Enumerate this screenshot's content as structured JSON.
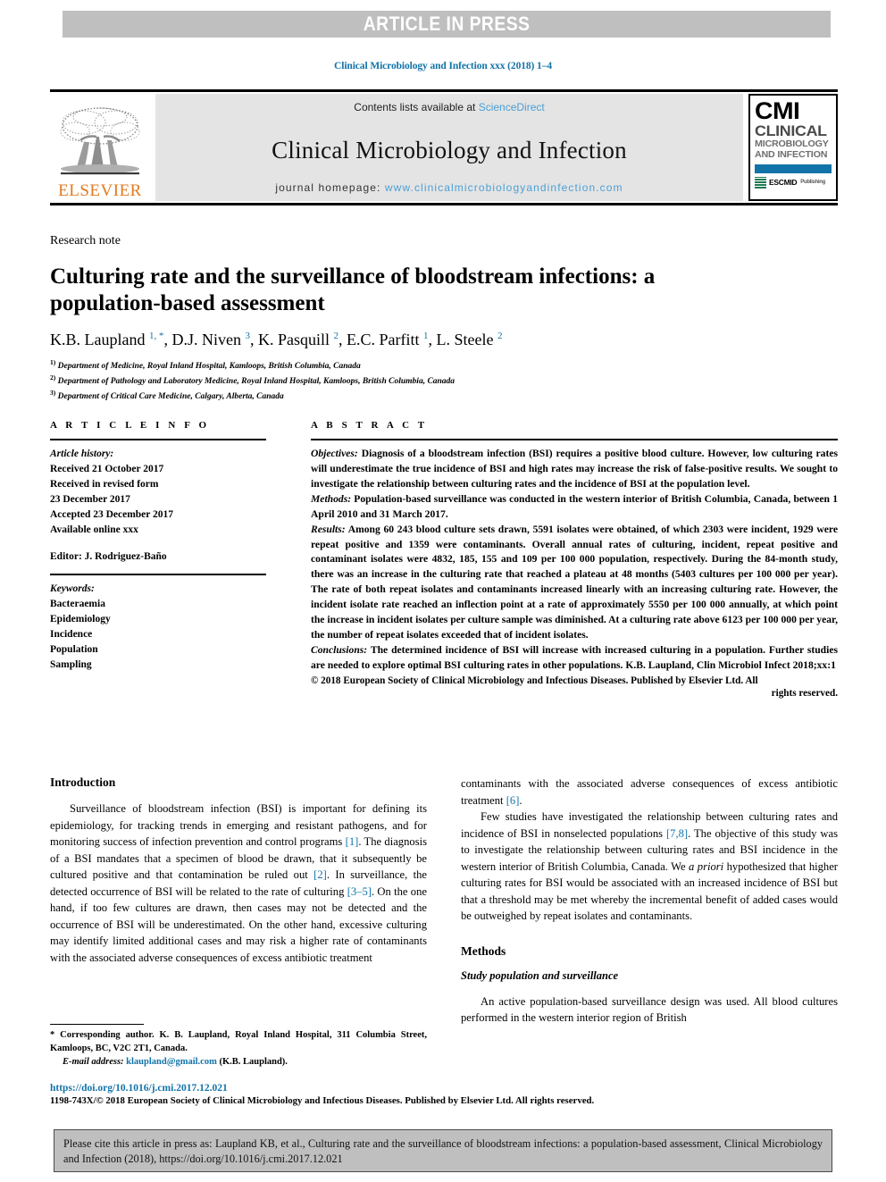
{
  "banner": {
    "text": "ARTICLE IN PRESS",
    "background": "#bfbfbf",
    "text_color": "#ffffff"
  },
  "running_head": {
    "text": "Clinical Microbiology and Infection xxx (2018) 1–4",
    "color": "#1273a8"
  },
  "masthead": {
    "publisher_name": "ELSEVIER",
    "publisher_color": "#e07b20",
    "contents_prefix": "Contents lists available at ",
    "contents_link": "ScienceDirect",
    "journal_name": "Clinical Microbiology and Infection",
    "homepage_label": "journal homepage: ",
    "homepage_url": "www.clinicalmicrobiologyandinfection.com",
    "link_color": "#4b9fd5",
    "cover": {
      "acronym": "CMI",
      "line1": "CLINICAL",
      "line2": "MICROBIOLOGY",
      "line3": "AND INFECTION",
      "bar_color": "#1273a8",
      "society": "ESCMID",
      "society_sub": "Publishing"
    }
  },
  "article": {
    "type": "Research note",
    "title": "Culturing rate and the surveillance of bloodstream infections: a population-based assessment",
    "authors": [
      {
        "name": "K.B. Laupland",
        "sup": "1, *"
      },
      {
        "name": "D.J. Niven",
        "sup": "3"
      },
      {
        "name": "K. Pasquill",
        "sup": "2"
      },
      {
        "name": "E.C. Parfitt",
        "sup": "1"
      },
      {
        "name": "L. Steele",
        "sup": "2"
      }
    ],
    "affiliations": [
      {
        "marker": "1)",
        "text": "Department of Medicine, Royal Inland Hospital, Kamloops, British Columbia, Canada"
      },
      {
        "marker": "2)",
        "text": "Department of Pathology and Laboratory Medicine, Royal Inland Hospital, Kamloops, British Columbia, Canada"
      },
      {
        "marker": "3)",
        "text": "Department of Critical Care Medicine, Calgary, Alberta, Canada"
      }
    ]
  },
  "article_info": {
    "heading": "A R T I C L E   I N F O",
    "history_label": "Article history:",
    "history": [
      "Received 21 October 2017",
      "Received in revised form",
      "23 December 2017",
      "Accepted 23 December 2017",
      "Available online xxx"
    ],
    "editor": "Editor: J. Rodriguez-Baño",
    "keywords_label": "Keywords:",
    "keywords": [
      "Bacteraemia",
      "Epidemiology",
      "Incidence",
      "Population",
      "Sampling"
    ]
  },
  "abstract": {
    "heading": "A B S T R A C T",
    "objectives_label": "Objectives:",
    "objectives": " Diagnosis of a bloodstream infection (BSI) requires a positive blood culture. However, low culturing rates will underestimate the true incidence of BSI and high rates may increase the risk of false-positive results. We sought to investigate the relationship between culturing rates and the incidence of BSI at the population level.",
    "methods_label": "Methods:",
    "methods": " Population-based surveillance was conducted in the western interior of British Columbia, Canada, between 1 April 2010 and 31 March 2017.",
    "results_label": "Results:",
    "results": " Among 60 243 blood culture sets drawn, 5591 isolates were obtained, of which 2303 were incident, 1929 were repeat positive and 1359 were contaminants. Overall annual rates of culturing, incident, repeat positive and contaminant isolates were 4832, 185, 155 and 109 per 100 000 population, respectively. During the 84-month study, there was an increase in the culturing rate that reached a plateau at 48 months (5403 cultures per 100 000 per year). The rate of both repeat isolates and contaminants increased linearly with an increasing culturing rate. However, the incident isolate rate reached an inflection point at a rate of approximately 5550 per 100 000 annually, at which point the increase in incident isolates per culture sample was diminished. At a culturing rate above 6123 per 100 000 per year, the number of repeat isolates exceeded that of incident isolates.",
    "conclusions_label": "Conclusions:",
    "conclusions": " The determined incidence of BSI will increase with increased culturing in a population. Further studies are needed to explore optimal BSI culturing rates in other populations. ",
    "self_citation": "K.B. Laupland, Clin Microbiol Infect 2018;xx:1",
    "copyright": "© 2018 European Society of Clinical Microbiology and Infectious Diseases. Published by Elsevier Ltd. All",
    "rights": "rights reserved."
  },
  "body": {
    "introduction_heading": "Introduction",
    "intro_p1_a": "Surveillance of bloodstream infection (BSI) is important for defining its epidemiology, for tracking trends in emerging and resistant pathogens, and for monitoring success of infection prevention and control programs ",
    "intro_ref1": "[1]",
    "intro_p1_b": ". The diagnosis of a BSI mandates that a specimen of blood be drawn, that it subsequently be cultured positive and that contamination be ruled out ",
    "intro_ref2": "[2]",
    "intro_p1_c": ". In surveillance, the detected occurrence of BSI will be related to the rate of culturing ",
    "intro_ref3": "[3–5]",
    "intro_p1_d": ". On the one hand, if too few cultures are drawn, then cases may not be detected and the occurrence of BSI will be underestimated. On the other hand, excessive culturing may identify limited additional cases and may risk a higher rate of contaminants with the associated adverse consequences of excess antibiotic treatment ",
    "intro_ref6": "[6]",
    "intro_p1_e": ".",
    "intro_p2_a": "Few studies have investigated the relationship between culturing rates and incidence of BSI in nonselected populations ",
    "intro_ref78": "[7,8]",
    "intro_p2_b": ". The objective of this study was to investigate the relationship between culturing rates and BSI incidence in the western interior of British Columbia, Canada. We ",
    "intro_apriori": "a priori",
    "intro_p2_c": " hypothesized that higher culturing rates for BSI would be associated with an increased incidence of BSI but that a threshold may be met whereby the incremental benefit of added cases would be outweighed by repeat isolates and contaminants.",
    "methods_heading": "Methods",
    "methods_subheading": "Study population and surveillance",
    "methods_p1": "An active population-based surveillance design was used. All blood cultures performed in the western interior region of British"
  },
  "footnotes": {
    "corresponding": "* Corresponding author. K. B. Laupland, Royal Inland Hospital, 311 Columbia Street, Kamloops, BC, V2C 2T1, Canada.",
    "email_label": "E-mail address:",
    "email": "klaupland@gmail.com",
    "email_suffix": " (K.B. Laupland).",
    "doi": "https://doi.org/10.1016/j.cmi.2017.12.021",
    "issn_line": "1198-743X/© 2018 European Society of Clinical Microbiology and Infectious Diseases. Published by Elsevier Ltd. All rights reserved."
  },
  "citation_footer": {
    "text": "Please cite this article in press as: Laupland KB, et al., Culturing rate and the surveillance of bloodstream infections: a population-based assessment, Clinical Microbiology and Infection (2018), https://doi.org/10.1016/j.cmi.2017.12.021",
    "background": "#bfbfbf"
  }
}
